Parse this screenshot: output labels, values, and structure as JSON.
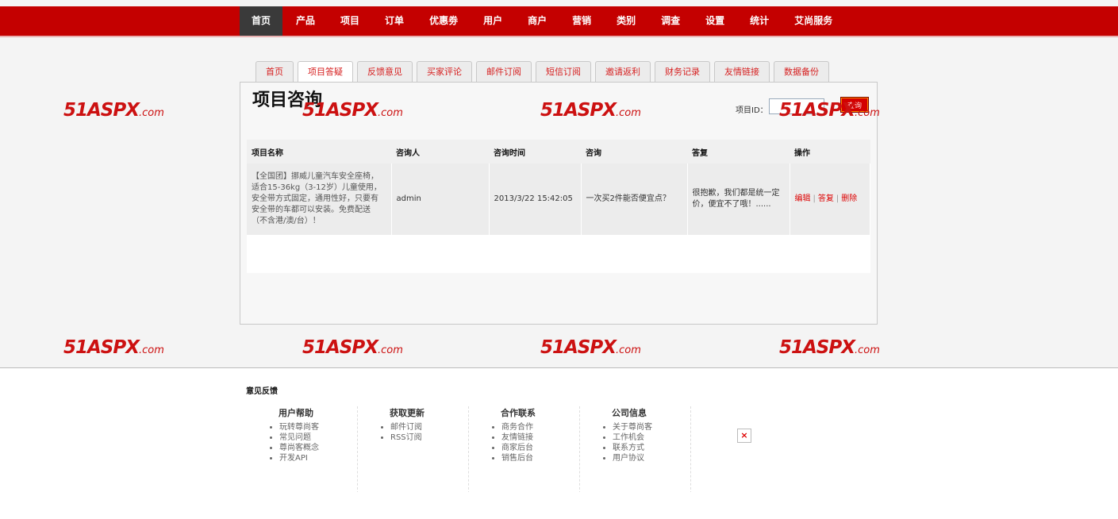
{
  "nav": {
    "items": [
      "首页",
      "产品",
      "项目",
      "订单",
      "优惠劵",
      "用户",
      "商户",
      "营销",
      "类别",
      "调查",
      "设置",
      "统计",
      "艾尚服务"
    ]
  },
  "tabs": [
    "首页",
    "项目答疑",
    "反馈意见",
    "买家评论",
    "邮件订阅",
    "短信订阅",
    "邀请返利",
    "财务记录",
    "友情链接",
    "数据备份"
  ],
  "panel": {
    "title": "项目咨询",
    "search_label": "项目ID：",
    "search_value": "",
    "search_button": "查询"
  },
  "table": {
    "headers": [
      "项目名称",
      "咨询人",
      "咨询时间",
      "咨询",
      "答复",
      "操作"
    ],
    "row": {
      "name": "【全国团】挪威儿童汽车安全座椅，适合15-36kg（3-12岁）儿童使用，安全带方式固定，通用性好，只要有安全带的车都可以安装。免费配送（不含港/澳/台）！",
      "user": "admin",
      "time": "2013/3/22 15:42:05",
      "question": "一次买2件能否便宜点？",
      "reply": "很抱歉，我们都是统一定价，便宜不了哦！......",
      "op_edit": "编辑",
      "op_reply": "答复",
      "op_delete": "删除",
      "sep": "|"
    }
  },
  "watermark": {
    "main": "51ASPX",
    "suffix": ".com"
  },
  "footer": {
    "feedback": "意见反馈",
    "cols": [
      {
        "title": "用户帮助",
        "items": [
          "玩转尊尚客",
          "常见问题",
          "尊尚客概念",
          "开发API"
        ]
      },
      {
        "title": "获取更新",
        "items": [
          "邮件订阅",
          "RSS订阅"
        ]
      },
      {
        "title": "合作联系",
        "items": [
          "商务合作",
          "友情链接",
          "商家后台",
          "销售后台"
        ]
      },
      {
        "title": "公司信息",
        "items": [
          "关于尊尚客",
          "工作机会",
          "联系方式",
          "用户协议"
        ]
      }
    ],
    "broken_image": "×"
  }
}
